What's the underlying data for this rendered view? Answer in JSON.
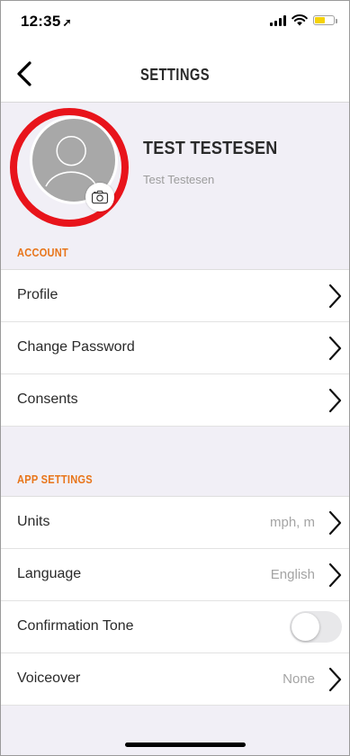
{
  "status_bar": {
    "time": "12:35",
    "location_glyph": "➚",
    "battery_color": "#f5d20a"
  },
  "nav": {
    "title": "SETTINGS",
    "back_icon": "chevron-left-icon"
  },
  "profile": {
    "display_name": "TEST TESTESEN",
    "username": "Test Testesen",
    "highlight_color": "#e8141b",
    "camera_icon": "camera-icon"
  },
  "account": {
    "header": "ACCOUNT",
    "items": [
      {
        "label": "Profile"
      },
      {
        "label": "Change Password"
      },
      {
        "label": "Consents"
      }
    ]
  },
  "app_settings": {
    "header": "APP SETTINGS",
    "items": [
      {
        "label": "Units",
        "value": "mph, m"
      },
      {
        "label": "Language",
        "value": "English"
      },
      {
        "label": "Confirmation Tone",
        "toggle_on": false
      },
      {
        "label": "Voiceover",
        "value": "None"
      }
    ]
  },
  "colors": {
    "accent": "#e8751a",
    "background": "#f1eff6"
  }
}
